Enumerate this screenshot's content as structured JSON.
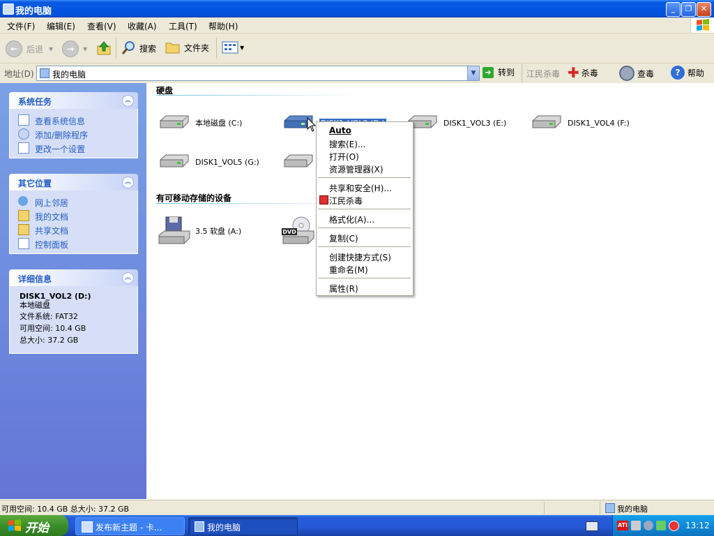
{
  "window": {
    "title": "我的电脑"
  },
  "menubar": [
    "文件(F)",
    "编辑(E)",
    "查看(V)",
    "收藏(A)",
    "工具(T)",
    "帮助(H)"
  ],
  "toolbar": {
    "back": "后退",
    "search": "搜索",
    "folders": "文件夹"
  },
  "address": {
    "label": "地址(D)",
    "value": "我的电脑",
    "go": "转到"
  },
  "antivirus": {
    "brand": "江民杀毒",
    "kill": "杀毒",
    "check": "查毒",
    "help": "帮助"
  },
  "panels": {
    "system": {
      "title": "系统任务",
      "items": [
        "查看系统信息",
        "添加/删除程序",
        "更改一个设置"
      ]
    },
    "places": {
      "title": "其它位置",
      "items": [
        "网上邻居",
        "我的文档",
        "共享文档",
        "控制面板"
      ]
    },
    "details": {
      "title": "详细信息",
      "name": "DISK1_VOL2 (D:)",
      "type": "本地磁盘",
      "fs": "文件系统: FAT32",
      "free": "可用空间: 10.4 GB",
      "total": "总大小: 37.2 GB"
    }
  },
  "content": {
    "hdd_header": "硬盘",
    "drives": [
      "本地磁盘 (C:)",
      "DISK1_VOL2 (D:)",
      "DISK1_VOL3 (E:)",
      "DISK1_VOL4 (F:)",
      "DISK1_VOL5 (G:)"
    ],
    "removable_header": "有可移动存储的设备",
    "removable": [
      "3.5 软盘 (A:)"
    ],
    "dvd_label": "DVD"
  },
  "context_menu": [
    "Auto",
    "搜索(E)...",
    "打开(O)",
    "资源管理器(X)",
    "共享和安全(H)...",
    "江民杀毒",
    "格式化(A)...",
    "复制(C)",
    "创建快捷方式(S)",
    "重命名(M)",
    "属性(R)"
  ],
  "statusbar": {
    "left": "可用空间: 10.4 GB 总大小: 37.2 GB",
    "right": "我的电脑"
  },
  "taskbar": {
    "start": "开始",
    "task1": "发布新主题 - 卡...",
    "task2": "我的电脑",
    "clock": "13:12"
  }
}
